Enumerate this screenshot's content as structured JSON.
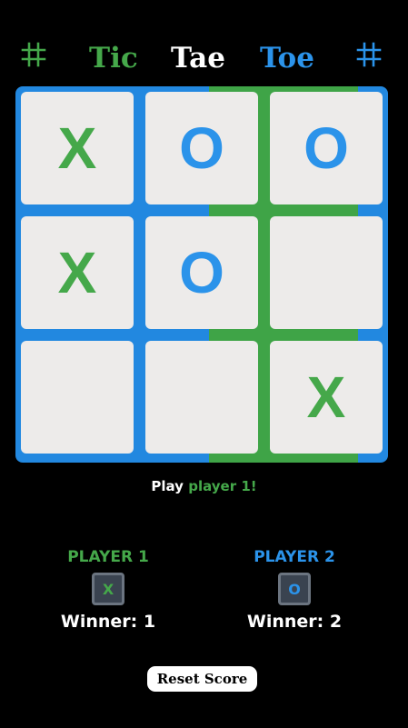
{
  "header": {
    "words": [
      "Tic",
      "Tae",
      "Toe"
    ],
    "left_icon": "hash-icon",
    "right_icon": "hash-icon"
  },
  "colors": {
    "player1": "#45a84a",
    "player2": "#2b93ea",
    "background": "#000000",
    "cell": "#edebea"
  },
  "board": {
    "cells": [
      "X",
      "O",
      "O",
      "X",
      "O",
      "",
      "",
      "",
      "X"
    ]
  },
  "status": {
    "prefix": "Play",
    "player": "player 1!"
  },
  "players": [
    {
      "name": "PLAYER 1",
      "mark": "X",
      "winner_text": "Winner: 1"
    },
    {
      "name": "PLAYER 2",
      "mark": "O",
      "winner_text": "Winner: 2"
    }
  ],
  "reset_label": "Reset Score"
}
